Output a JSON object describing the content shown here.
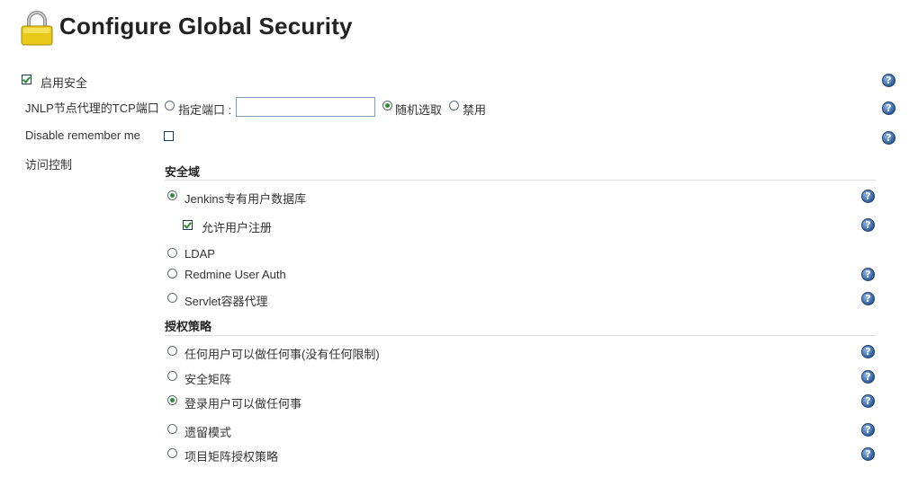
{
  "header": {
    "title": "Configure Global Security",
    "lock_icon": "lock-icon"
  },
  "enable_security": {
    "label": "启用安全",
    "checked": true
  },
  "jnlp": {
    "label": "JNLP节点代理的TCP端口",
    "fixed_label": "指定端口 :",
    "port_value": "",
    "random_label": "随机选取",
    "disable_label": "禁用",
    "selected": "random"
  },
  "remember_me": {
    "label": "Disable remember me",
    "checked": false
  },
  "access_control": {
    "label": "访问控制"
  },
  "security_realm": {
    "heading": "安全域",
    "options": [
      {
        "label": "Jenkins专有用户数据库",
        "selected": true
      },
      {
        "label": "LDAP",
        "selected": false
      },
      {
        "label": "Redmine User Auth",
        "selected": false
      },
      {
        "label": "Servlet容器代理",
        "selected": false
      }
    ],
    "allow_signup": {
      "label": "允许用户注册",
      "checked": true
    }
  },
  "authorization": {
    "heading": "授权策略",
    "options": [
      {
        "label": "任何用户可以做任何事(没有任何限制)",
        "selected": false
      },
      {
        "label": "安全矩阵",
        "selected": false
      },
      {
        "label": "登录用户可以做任何事",
        "selected": true
      },
      {
        "label": "遗留模式",
        "selected": false
      },
      {
        "label": "项目矩阵授权策略",
        "selected": false
      }
    ]
  },
  "help": {
    "glyph": "?",
    "icon": "help-icon"
  },
  "colors": {
    "help_blue": "#2f5f9e",
    "check_green": "#2e8b2e"
  }
}
